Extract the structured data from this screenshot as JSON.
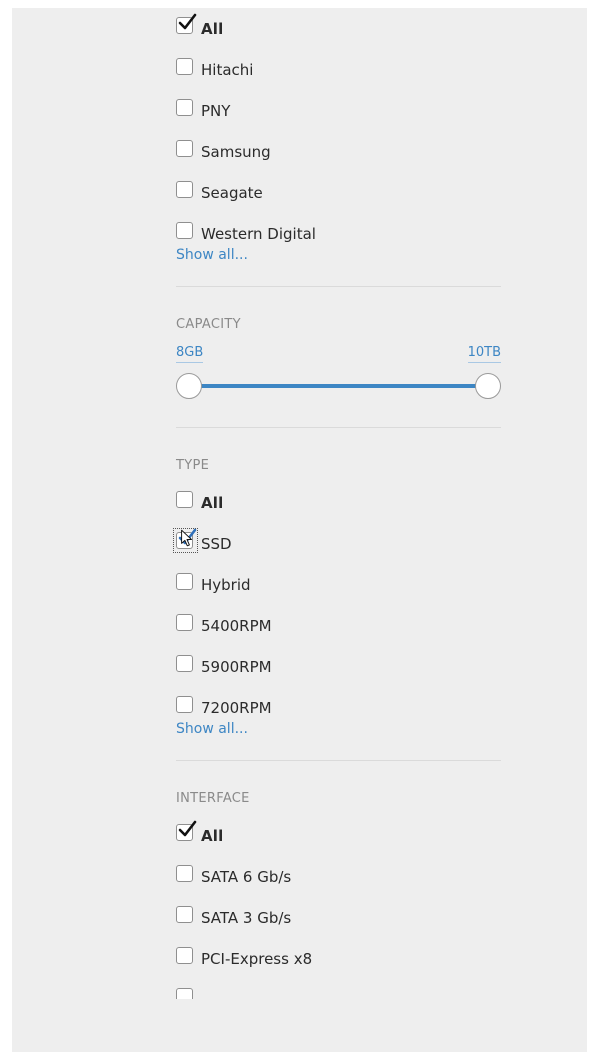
{
  "brand": {
    "items": [
      {
        "label": "All",
        "checked": true
      },
      {
        "label": "Hitachi",
        "checked": false
      },
      {
        "label": "PNY",
        "checked": false
      },
      {
        "label": "Samsung",
        "checked": false
      },
      {
        "label": "Seagate",
        "checked": false
      },
      {
        "label": "Western Digital",
        "checked": false
      }
    ],
    "show_all": "Show all..."
  },
  "capacity": {
    "title": "CAPACITY",
    "min_label": "8GB",
    "max_label": "10TB"
  },
  "type": {
    "title": "TYPE",
    "items": [
      {
        "label": "All",
        "checked": false
      },
      {
        "label": "SSD",
        "checked": true
      },
      {
        "label": "Hybrid",
        "checked": false
      },
      {
        "label": "5400RPM",
        "checked": false
      },
      {
        "label": "5900RPM",
        "checked": false
      },
      {
        "label": "7200RPM",
        "checked": false
      }
    ],
    "show_all": "Show all..."
  },
  "interface": {
    "title": "INTERFACE",
    "items": [
      {
        "label": "All",
        "checked": true
      },
      {
        "label": "SATA 6 Gb/s",
        "checked": false
      },
      {
        "label": "SATA 3 Gb/s",
        "checked": false
      },
      {
        "label": "PCI-Express x8",
        "checked": false
      }
    ]
  },
  "colors": {
    "accent": "#3d86c4",
    "check_black": "#111111",
    "check_blue": "#2f6fb8"
  },
  "icons": {
    "checkmark": "checkmark-icon",
    "cursor": "mouse-pointer-icon"
  }
}
